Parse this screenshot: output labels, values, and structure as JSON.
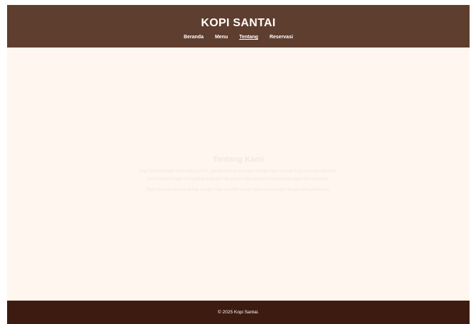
{
  "header": {
    "title": "KOPI SANTAI",
    "nav": [
      {
        "label": "Beranda"
      },
      {
        "label": "Menu"
      },
      {
        "label": "Tentang"
      },
      {
        "label": "Reservasi"
      }
    ],
    "active_nav": "Tentang"
  },
  "about": {
    "title": "Tentang Kami",
    "paragraph_1": "Kopi Santai berdiri sejak tahun 2020, menghadirkan suasana hangat dan nyaman bagi para pecinta kopi. Kami berkomitmen menyajikan kopi dari biji pilihan dari seluruh Indonesia dengan cita rasa khas.",
    "paragraph_2": "Kami percaya bahwa setiap cangkir kopi memiliki cerita. Mari nikmati kopi dengan kafe pilihanmu."
  },
  "footer": {
    "text": "© 2025 Kopi Santai."
  },
  "colors": {
    "header_bg": "#5e3e2f",
    "page_bg": "#fff6ef",
    "footer_bg": "#3e1b10"
  }
}
